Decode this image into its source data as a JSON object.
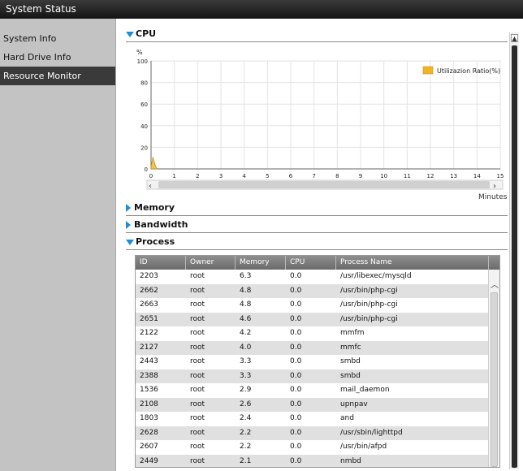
{
  "window": {
    "title": "System Status"
  },
  "sidebar": {
    "items": [
      {
        "label": "System Info",
        "active": false
      },
      {
        "label": "Hard Drive Info",
        "active": false
      },
      {
        "label": "Resource Monitor",
        "active": true
      }
    ]
  },
  "sections": {
    "cpu": "CPU",
    "memory": "Memory",
    "bandwidth": "Bandwidth",
    "process": "Process"
  },
  "chart_data": {
    "type": "area",
    "title": "",
    "ylabel": "%",
    "xlabel": "Minutes",
    "ylim": [
      0,
      100
    ],
    "yticks": [
      0,
      20,
      40,
      60,
      80,
      100
    ],
    "xticks": [
      "0",
      "1",
      "2",
      "3",
      "4",
      "5",
      "6",
      "7",
      "8",
      "9",
      "10",
      "11",
      "12",
      "13",
      "14",
      "15"
    ],
    "grid": true,
    "legend_position": "top-right",
    "series": [
      {
        "name": "Utilizazion Ratio(%)",
        "color": "#f0b429",
        "x": [
          0,
          0.08,
          0.17,
          0.25
        ],
        "y": [
          2,
          11,
          4,
          0
        ]
      }
    ]
  },
  "process_table": {
    "headers": [
      "ID",
      "Owner",
      "Memory",
      "CPU",
      "Process Name"
    ],
    "rows": [
      [
        "2203",
        "root",
        "6.3",
        "0.0",
        "/usr/libexec/mysqld"
      ],
      [
        "2662",
        "root",
        "4.8",
        "0.0",
        "/usr/bin/php-cgi"
      ],
      [
        "2663",
        "root",
        "4.8",
        "0.0",
        "/usr/bin/php-cgi"
      ],
      [
        "2651",
        "root",
        "4.6",
        "0.0",
        "/usr/bin/php-cgi"
      ],
      [
        "2122",
        "root",
        "4.2",
        "0.0",
        "mmfm"
      ],
      [
        "2127",
        "root",
        "4.0",
        "0.0",
        "mmfc"
      ],
      [
        "2443",
        "root",
        "3.3",
        "0.0",
        "smbd"
      ],
      [
        "2388",
        "root",
        "3.3",
        "0.0",
        "smbd"
      ],
      [
        "1536",
        "root",
        "2.9",
        "0.0",
        "mail_daemon"
      ],
      [
        "2108",
        "root",
        "2.6",
        "0.0",
        "upnpav"
      ],
      [
        "1803",
        "root",
        "2.4",
        "0.0",
        "and"
      ],
      [
        "2628",
        "root",
        "2.2",
        "0.0",
        "/usr/sbin/lighttpd"
      ],
      [
        "2607",
        "root",
        "2.2",
        "0.0",
        "/usr/bin/afpd"
      ],
      [
        "2449",
        "root",
        "2.1",
        "0.0",
        "nmbd"
      ]
    ]
  }
}
